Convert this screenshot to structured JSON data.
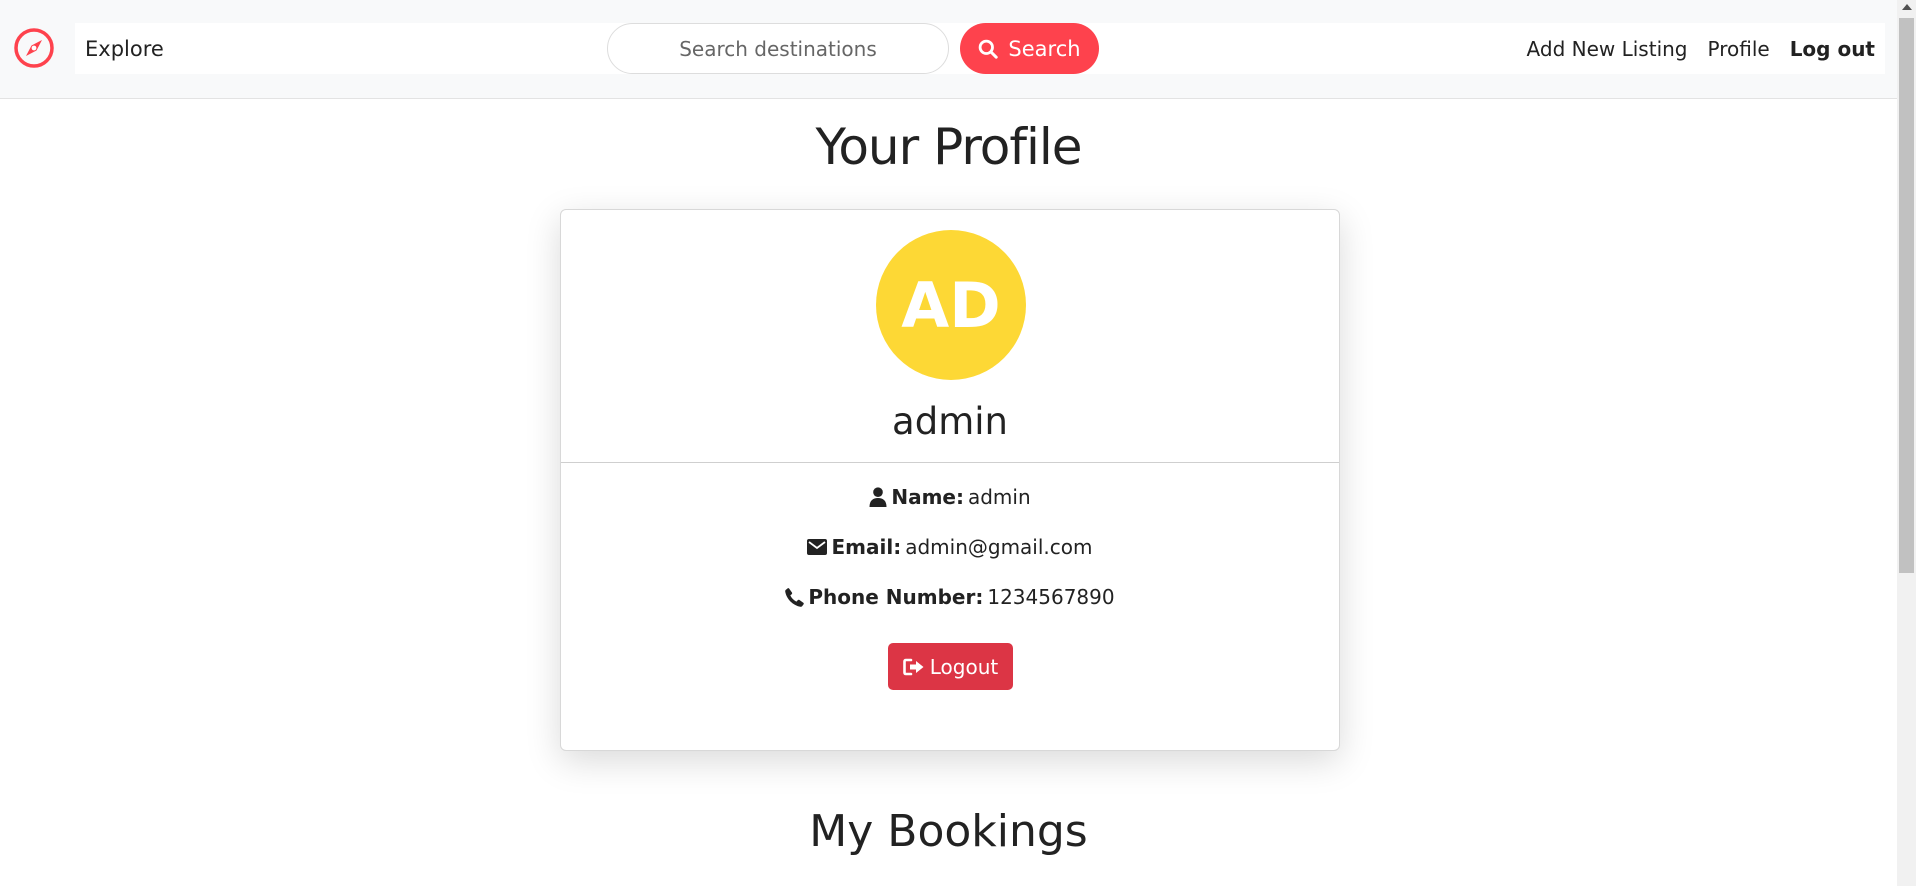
{
  "navbar": {
    "brand_icon": "compass-icon",
    "explore_label": "Explore",
    "search": {
      "placeholder": "Search destinations",
      "button_label": "Search",
      "button_icon": "search-icon"
    },
    "links": {
      "add_listing": "Add New Listing",
      "profile": "Profile",
      "logout": "Log out"
    }
  },
  "page": {
    "title": "Your Profile",
    "bookings_title": "My Bookings"
  },
  "profile": {
    "avatar_initials": "AD",
    "username": "admin",
    "fields": {
      "name": {
        "label": "Name:",
        "value": "admin",
        "icon": "user-icon"
      },
      "email": {
        "label": "Email:",
        "value": "admin@gmail.com",
        "icon": "envelope-icon"
      },
      "phone": {
        "label": "Phone Number:",
        "value": "1234567890",
        "icon": "phone-icon"
      }
    },
    "logout_button": {
      "label": "Logout",
      "icon": "sign-out-icon"
    }
  },
  "colors": {
    "brand": "#fe424d",
    "avatar": "#fdd835",
    "danger": "#dc3545",
    "navbar_bg": "#f8f9fa"
  }
}
